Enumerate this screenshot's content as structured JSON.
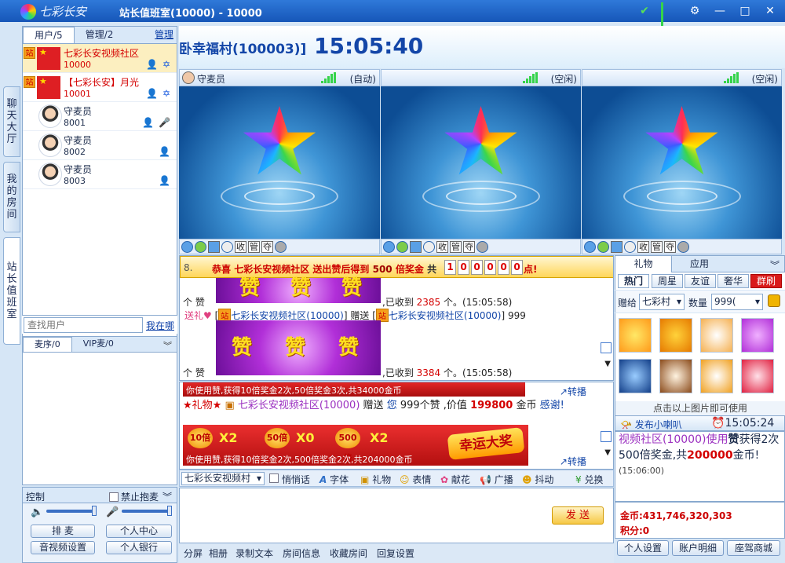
{
  "titlebar": {
    "logo": "七彩长安",
    "title": "站长值班室(10000) - 10000"
  },
  "sidebar_tabs": [
    "聊天大厅",
    "我的房间",
    "站长值班室"
  ],
  "user_panel": {
    "tabs": [
      "用户/5",
      "管理/2"
    ],
    "manage_link": "管理",
    "users": [
      {
        "name": "七彩长安视频社区",
        "id": "10000",
        "badge": "站"
      },
      {
        "name": "【七彩长安】月光",
        "id": "10001",
        "badge": "站"
      },
      {
        "name": "守麦员",
        "id": "8001"
      },
      {
        "name": "守麦员",
        "id": "8002"
      },
      {
        "name": "守麦员",
        "id": "8003"
      }
    ],
    "search_placeholder": "查找用户",
    "search_link": "我在哪"
  },
  "mic_queue": {
    "tabs": [
      "麦序/0",
      "VIP麦/0"
    ]
  },
  "control": {
    "title": "控制",
    "forbid_hug": "禁止抱麦",
    "buttons": [
      "排 麦",
      "个人中心",
      "音视频设置",
      "个人银行"
    ]
  },
  "banner": {
    "room": "卧幸福村(100003)]",
    "clock": "15:05:40"
  },
  "video_slots": [
    {
      "label": "守麦员",
      "status": "(自动)"
    },
    {
      "label": "",
      "status": "(空闲)"
    },
    {
      "label": "",
      "status": "(空闲)"
    }
  ],
  "video_tools": [
    "收",
    "管",
    "夺"
  ],
  "notice": {
    "num": "8.",
    "text_prefix": "恭喜",
    "text_name": "七彩长安视频社区",
    "text_mid": "送出赞后得到",
    "text_mult": "500",
    "text_unit": "倍奖金",
    "text_total": "共",
    "digits": [
      "1",
      "0",
      "0",
      "0",
      "0",
      "0"
    ],
    "text_tail": "点!"
  },
  "chat": {
    "zan_word": "赞",
    "line1": {
      "a": "个 赞",
      "b": ",已收到",
      "count": "2385",
      "c": "个。(15:05:58)"
    },
    "gift_line": {
      "a": "送礼",
      "from": "站",
      "from_name": "七彩长安视频社区(10000)",
      "mid": "赠送",
      "to": "站",
      "to_name": "七彩长安视频社区(10000)",
      "qty": "999"
    },
    "line2": {
      "a": "个 赞",
      "b": ",已收到",
      "count": "3384",
      "c": "个。(15:05:58)"
    }
  },
  "chat2": {
    "bar1": "你使用赞,获得10倍奖金2次,50倍奖金3次,共34000金币",
    "share": "转播",
    "gift_line": {
      "star": "★礼物★",
      "name": "七彩长安视频社区(10000)",
      "mid": "赠送",
      "you": "您",
      "desc": "999个赞 ,价值",
      "value": "199800",
      "unit": "金币",
      "thanks": "感谢!"
    },
    "lucky": {
      "coins": [
        "10倍",
        "50倍",
        "500倍"
      ],
      "mults": [
        "X2",
        "X0",
        "X2"
      ],
      "title": "幸运大奖",
      "sub": "你使用赞,获得10倍奖金2次,500倍奖金2次,共204000金币"
    }
  },
  "chat_toolbar": {
    "target": "七彩长安视频村",
    "items": [
      "悄悄话",
      "字体",
      "礼物",
      "表情",
      "献花",
      "广播",
      "抖动",
      "兑换"
    ]
  },
  "send_label": "发 送",
  "bottom_bar": [
    "分屏",
    "相册",
    "录制文本",
    "房间信息",
    "收藏房间",
    "回复设置"
  ],
  "right_panel": {
    "tabs": [
      "礼物",
      "应用"
    ],
    "categories": [
      "热门",
      "周星",
      "友谊",
      "奢华",
      "群刷"
    ],
    "give_label": "赠给",
    "give_target": "七彩村",
    "qty_label": "数量",
    "qty_value": "999(",
    "gift_hint": "点击以上图片即可使用",
    "horn_label": "发布小喇叭",
    "horn_time": "15:05:24",
    "chat_text_a": "视频社区(10000)使用",
    "chat_bold": "赞",
    "chat_text_b": "获得2次500倍奖金,共",
    "chat_value": "200000",
    "chat_text_c": "金币!",
    "chat_time": "(15:06:00)",
    "gold": "金币:431,746,320,303",
    "points": "积分:0",
    "buttons": [
      "个人设置",
      "账户明细",
      "座驾商城"
    ]
  },
  "colors": {
    "titlebar": "#1f66c8",
    "accent": "#1346a8",
    "highlight_red": "#d40000"
  }
}
